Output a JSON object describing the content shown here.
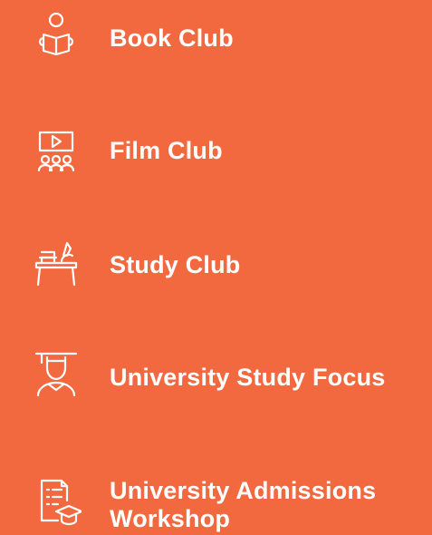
{
  "background_color": "#F2683F",
  "text_color": "#FFFFFF",
  "items": [
    {
      "label": "Book Club",
      "icon": "reading-person-icon"
    },
    {
      "label": "Film Club",
      "icon": "screen-audience-icon"
    },
    {
      "label": "Study Club",
      "icon": "study-desk-icon"
    },
    {
      "label": "University Study Focus",
      "icon": "graduate-icon"
    },
    {
      "label": "University Admissions Workshop",
      "icon": "document-graduation-cap-icon"
    }
  ]
}
